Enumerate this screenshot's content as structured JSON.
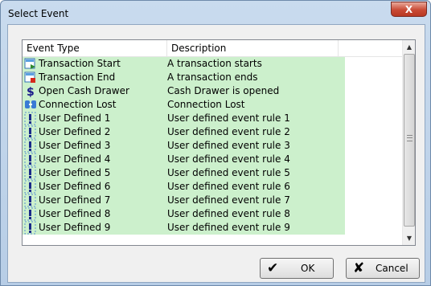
{
  "window": {
    "title": "Select Event",
    "close_glyph": "X"
  },
  "columns": [
    "Event Type",
    "Description"
  ],
  "rows": [
    {
      "icon": "transaction-start-icon",
      "type": "Transaction Start",
      "desc": "A transaction starts"
    },
    {
      "icon": "transaction-end-icon",
      "type": "Transaction End",
      "desc": "A transaction ends"
    },
    {
      "icon": "dollar-icon",
      "type": "Open Cash Drawer",
      "desc": "Cash Drawer is opened"
    },
    {
      "icon": "connection-lost-icon",
      "type": "Connection Lost",
      "desc": "Connection Lost"
    },
    {
      "icon": "exclamation-icon",
      "type": "User Defined 1",
      "desc": "User defined event rule 1"
    },
    {
      "icon": "exclamation-icon",
      "type": "User Defined 2",
      "desc": "User defined event rule 2"
    },
    {
      "icon": "exclamation-icon",
      "type": "User Defined 3",
      "desc": "User defined event rule 3"
    },
    {
      "icon": "exclamation-icon",
      "type": "User Defined 4",
      "desc": "User defined event rule 4"
    },
    {
      "icon": "exclamation-icon",
      "type": "User Defined 5",
      "desc": "User defined event rule 5"
    },
    {
      "icon": "exclamation-icon",
      "type": "User Defined 6",
      "desc": "User defined event rule 6"
    },
    {
      "icon": "exclamation-icon",
      "type": "User Defined 7",
      "desc": "User defined event rule 7"
    },
    {
      "icon": "exclamation-icon",
      "type": "User Defined 8",
      "desc": "User defined event rule 8"
    },
    {
      "icon": "exclamation-icon",
      "type": "User Defined 9",
      "desc": "User defined event rule 9"
    }
  ],
  "buttons": {
    "ok": "OK",
    "cancel": "Cancel"
  },
  "colors": {
    "row_highlight": "#ccf0cc",
    "close_red": "#c94a35"
  }
}
